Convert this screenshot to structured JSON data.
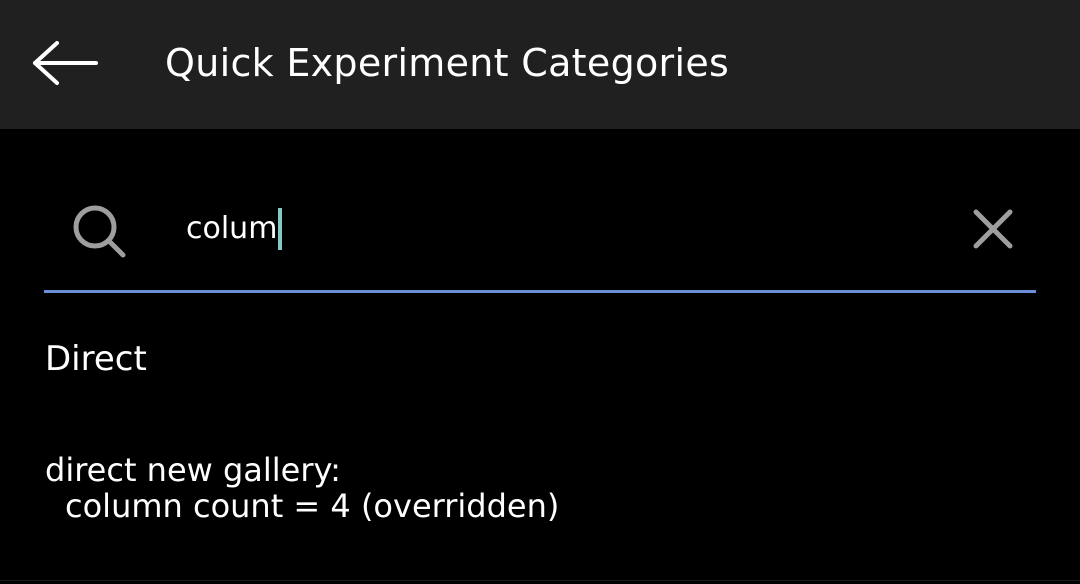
{
  "app_bar": {
    "title": "Quick Experiment Categories",
    "back_icon": "arrow-left-icon"
  },
  "search": {
    "icon": "search-icon",
    "value": "colum",
    "clear_icon": "close-icon",
    "caret_color": "#80cbc4",
    "underline_color": "#6b8fd6"
  },
  "results": {
    "section_title": "Direct",
    "items": [
      {
        "title": "direct new gallery:",
        "value": "column count = 4 (overridden)"
      }
    ]
  },
  "colors": {
    "background": "#000000",
    "app_bar": "#202020",
    "text": "#ffffff",
    "icon": "#9e9e9e"
  }
}
